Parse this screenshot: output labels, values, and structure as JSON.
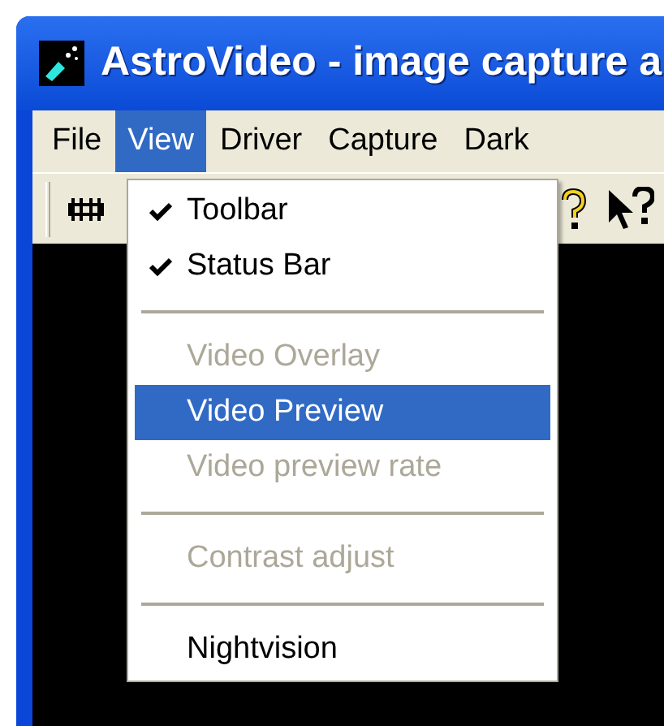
{
  "window": {
    "title": "AstroVideo - image capture a"
  },
  "menu_bar": [
    {
      "label": "File",
      "selected": false
    },
    {
      "label": "View",
      "selected": true
    },
    {
      "label": "Driver",
      "selected": false
    },
    {
      "label": "Capture",
      "selected": false
    },
    {
      "label": "Dark",
      "selected": false
    }
  ],
  "view_menu": [
    {
      "kind": "item",
      "label": "Toolbar",
      "checked": true,
      "disabled": false,
      "selected": false
    },
    {
      "kind": "item",
      "label": "Status Bar",
      "checked": true,
      "disabled": false,
      "selected": false
    },
    {
      "kind": "separator"
    },
    {
      "kind": "item",
      "label": "Video Overlay",
      "checked": false,
      "disabled": true,
      "selected": false
    },
    {
      "kind": "item",
      "label": "Video Preview",
      "checked": false,
      "disabled": false,
      "selected": true
    },
    {
      "kind": "item",
      "label": "Video preview rate",
      "checked": false,
      "disabled": true,
      "selected": false
    },
    {
      "kind": "separator"
    },
    {
      "kind": "item",
      "label": "Contrast adjust",
      "checked": false,
      "disabled": true,
      "selected": false
    },
    {
      "kind": "separator"
    },
    {
      "kind": "item",
      "label": "Nightvision",
      "checked": false,
      "disabled": false,
      "selected": false
    }
  ]
}
